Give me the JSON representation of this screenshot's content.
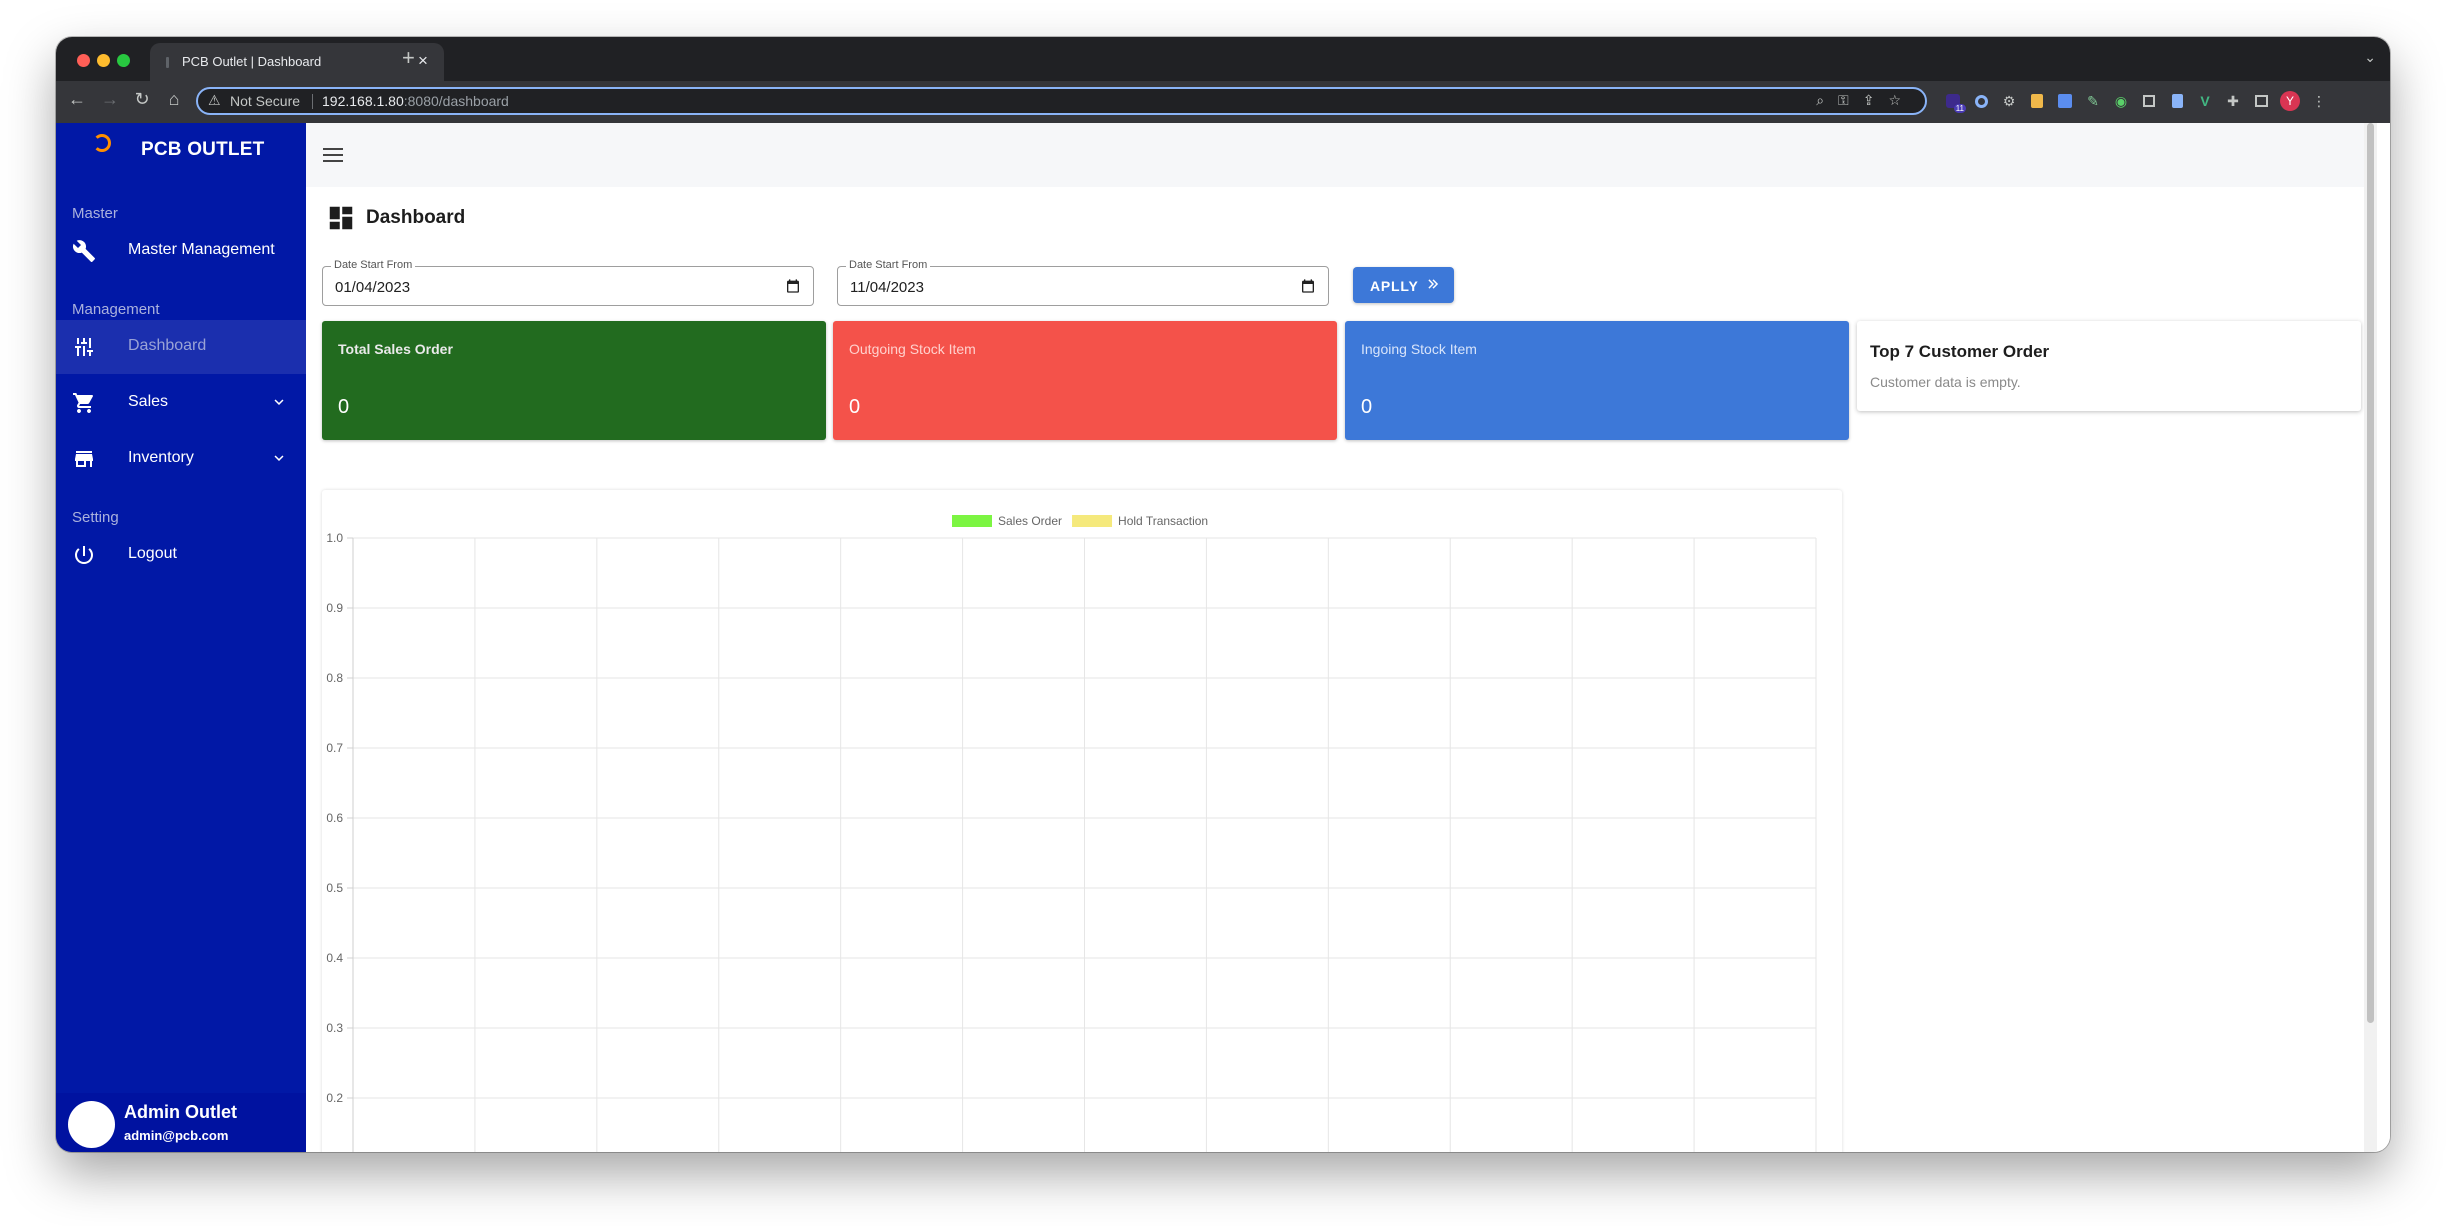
{
  "browser": {
    "tab_title": "PCB Outlet | Dashboard",
    "tab_close": "×",
    "new_tab": "+",
    "security_label": "Not Secure",
    "url_host": "192.168.1.80",
    "url_rest": ":8080/dashboard",
    "profile_initial": "Y",
    "ext_badge": "11"
  },
  "sidebar": {
    "brand": "PCB OUTLET",
    "sections": {
      "master": "Master",
      "management": "Management",
      "setting": "Setting"
    },
    "items": {
      "master_management": "Master Management",
      "dashboard": "Dashboard",
      "sales": "Sales",
      "inventory": "Inventory",
      "logout": "Logout"
    },
    "user": {
      "name": "Admin Outlet",
      "email": "admin@pcb.com"
    }
  },
  "page": {
    "title": "Dashboard",
    "date_from": {
      "label": "Date Start From",
      "value": "01/04/2023"
    },
    "date_to": {
      "label": "Date Start From",
      "value": "11/04/2023"
    },
    "apply_label": "APLLY"
  },
  "cards": {
    "total_sales": {
      "title": "Total Sales Order",
      "value": "0",
      "color": "#226b1f"
    },
    "outgoing": {
      "title": "Outgoing Stock Item",
      "value": "0",
      "color": "#f4524a"
    },
    "ingoing": {
      "title": "Ingoing Stock Item",
      "value": "0",
      "color": "#3d78d8"
    }
  },
  "customers": {
    "title": "Top 7 Customer Order",
    "empty": "Customer data is empty."
  },
  "colors": {
    "sidebar": "#0118a6",
    "accent": "#3d78d8"
  },
  "chart_data": {
    "type": "bar",
    "title": "",
    "xlabel": "",
    "ylabel": "",
    "categories": [
      "",
      "",
      "",
      "",
      "",
      "",
      "",
      "",
      "",
      "",
      "",
      ""
    ],
    "series": [
      {
        "name": "Sales Order",
        "color": "#7cf542",
        "values": []
      },
      {
        "name": "Hold Transaction",
        "color": "#f5e97c",
        "values": []
      }
    ],
    "y_ticks": [
      "1.0",
      "0.9",
      "0.8",
      "0.7",
      "0.6",
      "0.5",
      "0.4",
      "0.3",
      "0.2"
    ],
    "ylim": [
      0.2,
      1.0
    ],
    "grid": true,
    "legend": "top-center"
  }
}
